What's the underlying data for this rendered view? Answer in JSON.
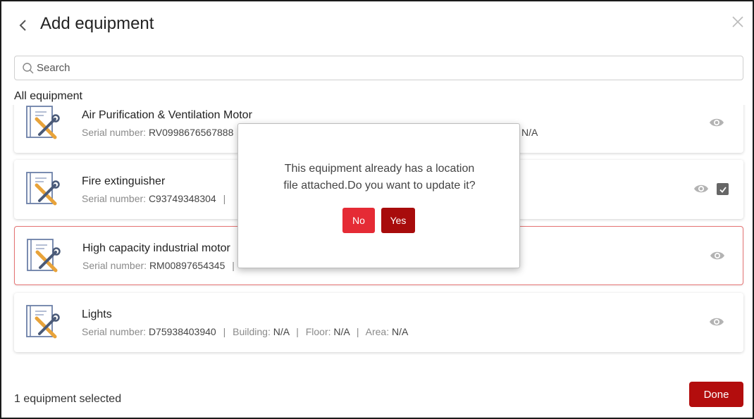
{
  "header": {
    "title": "Add equipment"
  },
  "search": {
    "placeholder": "Search",
    "value": ""
  },
  "section_label": "All equipment",
  "equipment": [
    {
      "name": "Air Purification & Ventilation Motor",
      "serial_label": "Serial number:",
      "serial": "RV0998676567888",
      "visible_tail": "N/A"
    },
    {
      "name": "Fire extinguisher",
      "serial_label": "Serial number:",
      "serial": "C93749348304",
      "checked": true
    },
    {
      "name": "High capacity industrial motor",
      "serial_label": "Serial number:",
      "serial": "RM00897654345",
      "highlighted": true
    },
    {
      "name": "Lights",
      "serial_label": "Serial number:",
      "serial": "D75938403940",
      "building_label": "Building:",
      "building": "N/A",
      "floor_label": "Floor:",
      "floor": "N/A",
      "area_label": "Area:",
      "area": "N/A"
    }
  ],
  "dialog": {
    "line1": "This equipment already has a location",
    "line2": "file attached.Do you want to update it?",
    "no_label": "No",
    "yes_label": "Yes"
  },
  "footer": {
    "status": "1 equipment selected",
    "done_label": "Done"
  },
  "colors": {
    "primary_red": "#b30d0d",
    "no_red": "#e52b35",
    "yes_red": "#a80c0c",
    "highlight_border": "#e57373"
  },
  "icons": {
    "back": "chevron-left-icon",
    "close": "close-icon",
    "search": "search-icon",
    "equipment": "equipment-tools-icon",
    "view": "eye-icon",
    "check": "checkbox-checked-icon"
  }
}
